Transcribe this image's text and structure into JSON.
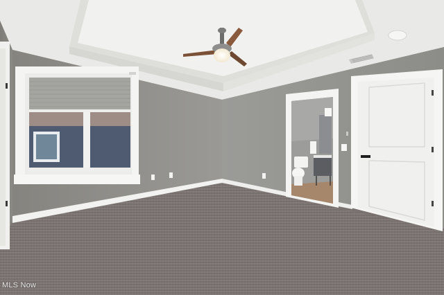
{
  "image": {
    "watermark_text": "MLS Now",
    "scene_elements": [
      "tray-ceiling",
      "ceiling-fan",
      "smoke-detector",
      "hvac-vent",
      "window-with-blinds",
      "bathroom-doorway",
      "toilet",
      "bathroom-vanity",
      "closet-door",
      "light-switch",
      "electrical-outlet",
      "carpet-floor",
      "baseboard"
    ],
    "colors": {
      "ceiling": "#eeeeec",
      "walls": "#8e8e8a",
      "trim": "#f4f4f2",
      "carpet": "#7d7573",
      "fan_blade": "#8a5a3c"
    }
  }
}
